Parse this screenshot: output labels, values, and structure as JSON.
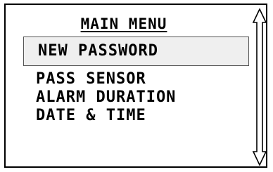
{
  "menu": {
    "title": "MAIN MENU",
    "items": [
      {
        "label": "NEW PASSWORD",
        "selected": true
      },
      {
        "label": "PASS SENSOR",
        "selected": false
      },
      {
        "label": "ALARM DURATION",
        "selected": false
      },
      {
        "label": "DATE & TIME",
        "selected": false
      }
    ]
  },
  "scrollbar": {
    "icon": "double-arrow-vertical-icon"
  }
}
